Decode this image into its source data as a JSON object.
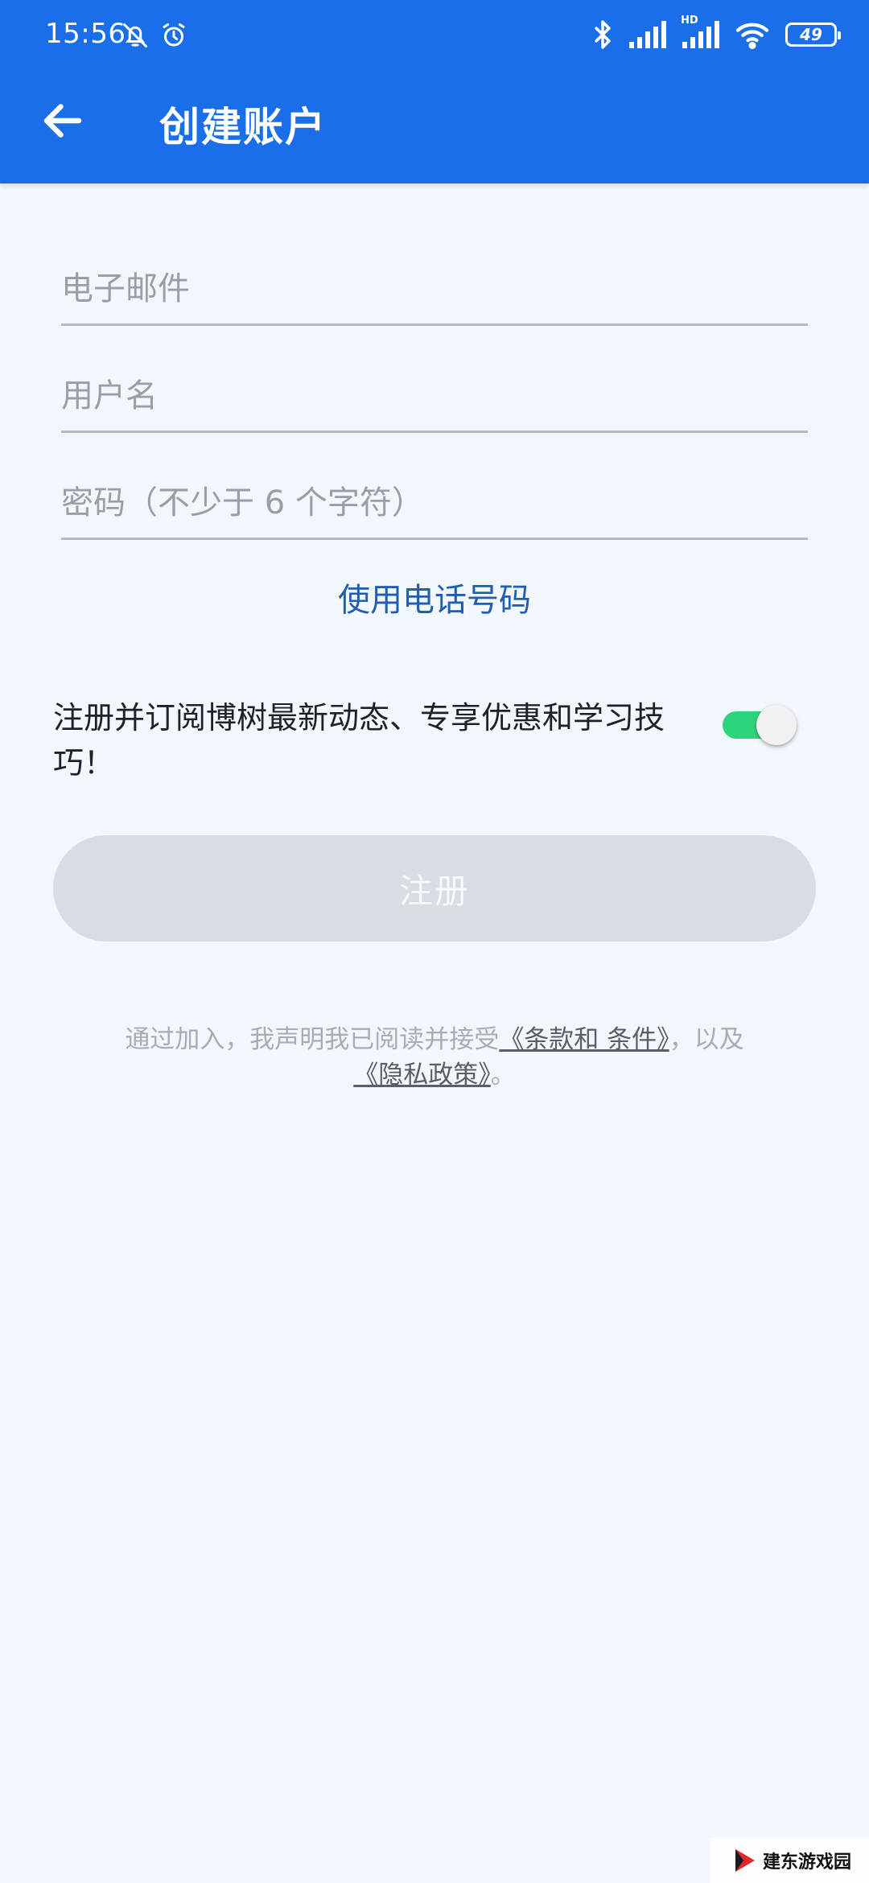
{
  "status_bar": {
    "time": "15:56",
    "battery": "49",
    "icons": [
      "bell-off-icon",
      "alarm-icon",
      "bluetooth-icon",
      "signal-icon",
      "hd-signal-icon",
      "wifi-icon",
      "battery-icon"
    ],
    "hd_label": "HD"
  },
  "header": {
    "title": "创建账户",
    "back_icon": "arrow-left-icon"
  },
  "form": {
    "email_placeholder": "电子邮件",
    "username_placeholder": "用户名",
    "password_placeholder": "密码（不少于 6 个字符）",
    "phone_link": "使用电话号码"
  },
  "subscribe": {
    "text": "注册并订阅博树最新动态、专享优惠和学习技巧！",
    "enabled": true
  },
  "register_button": "注册",
  "legal": {
    "prefix": "通过加入，我声明我已阅读并接受",
    "terms_link": "《条款和 条件》",
    "middle": "，以及",
    "privacy_link": "《隐私政策》",
    "suffix": "。"
  },
  "watermark": {
    "text": "建东游戏园"
  },
  "colors": {
    "header_bg": "#1a6fe8",
    "page_bg": "#f2f6fd",
    "link_blue": "#1f5fae",
    "toggle_on": "#2bd67b",
    "button_disabled": "#d7dde3"
  }
}
